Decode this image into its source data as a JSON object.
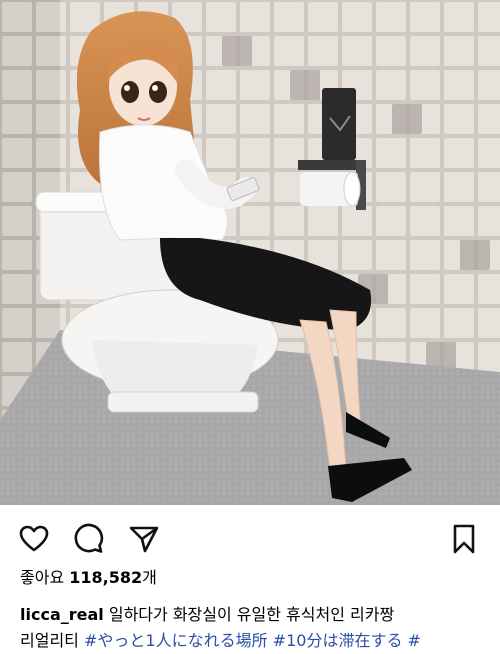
{
  "post": {
    "image_alt_subject": "doll-on-toilet-photo",
    "actions": {
      "like_icon": "heart-outline-icon",
      "comment_icon": "comment-bubble-icon",
      "share_icon": "paper-plane-icon",
      "save_icon": "bookmark-outline-icon"
    },
    "likes": {
      "label": "좋아요",
      "count": "118,582",
      "suffix": "개"
    },
    "caption": {
      "username": "licca_real",
      "text_line1": "일하다가 화장실이 유일한 휴식처인 리카짱",
      "text_line2_prefix": "리얼리티",
      "hashtags": [
        "#やっと1人になれる場所",
        "#10分は滞在する",
        "#"
      ]
    }
  },
  "colors": {
    "tag_blue": "#2b4fa6",
    "icon": "#111111"
  }
}
